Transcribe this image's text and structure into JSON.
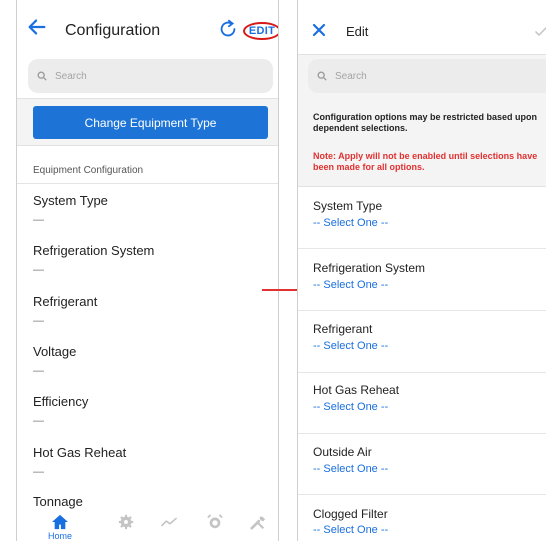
{
  "left": {
    "title": "Configuration",
    "edit_label": "EDIT",
    "search_placeholder": "Search",
    "change_button": "Change Equipment Type",
    "section_label": "Equipment Configuration",
    "fields": [
      {
        "label": "System Type",
        "value": "—"
      },
      {
        "label": "Refrigeration System",
        "value": "—"
      },
      {
        "label": "Refrigerant",
        "value": "—"
      },
      {
        "label": "Voltage",
        "value": "—"
      },
      {
        "label": "Efficiency",
        "value": "—"
      },
      {
        "label": "Hot Gas Reheat",
        "value": "—"
      },
      {
        "label": "Tonnage",
        "value": ""
      }
    ],
    "tabs": [
      {
        "label": "Home",
        "icon": "home-icon",
        "active": true
      },
      {
        "label": "",
        "icon": "gear-icon"
      },
      {
        "label": "",
        "icon": "trend-icon"
      },
      {
        "label": "",
        "icon": "alarm-icon"
      },
      {
        "label": "",
        "icon": "tools-icon"
      }
    ]
  },
  "right": {
    "title": "Edit",
    "search_placeholder": "Search",
    "info_note": "Configuration options may be restricted based upon dependent selections.",
    "warn_note": "Note: Apply will not be enabled until selections have been made for all options.",
    "fields": [
      {
        "label": "System Type",
        "value": "-- Select One --"
      },
      {
        "label": "Refrigeration System",
        "value": "-- Select One --"
      },
      {
        "label": "Refrigerant",
        "value": "-- Select One --"
      },
      {
        "label": "Hot Gas Reheat",
        "value": "-- Select One --"
      },
      {
        "label": "Outside Air",
        "value": "-- Select One --"
      },
      {
        "label": "Clogged Filter",
        "value": "-- Select One --"
      }
    ]
  },
  "colors": {
    "accent": "#1a6fe0",
    "button": "#1e74d6",
    "annotation": "#e23131"
  }
}
